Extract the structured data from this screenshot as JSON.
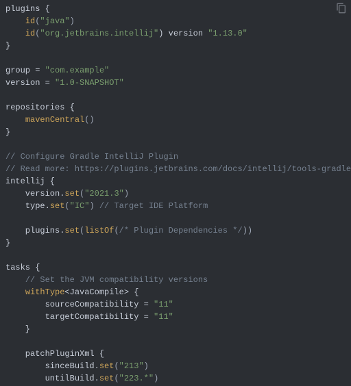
{
  "code": {
    "l1a": "plugins {",
    "l2a": "    ",
    "l2b": "id",
    "l2c": "(",
    "l2d": "\"java\"",
    "l2e": ")",
    "l3a": "    ",
    "l3b": "id",
    "l3c": "(",
    "l3d": "\"org.jetbrains.intellij\"",
    "l3e": ") version ",
    "l3f": "\"1.13.0\"",
    "l4a": "}",
    "l5a": "",
    "l6a": "group = ",
    "l6b": "\"com.example\"",
    "l7a": "version = ",
    "l7b": "\"1.0-SNAPSHOT\"",
    "l8a": "",
    "l9a": "repositories {",
    "l10a": "    ",
    "l10b": "mavenCentral",
    "l10c": "()",
    "l11a": "}",
    "l12a": "",
    "l13a": "// Configure Gradle IntelliJ Plugin",
    "l14a": "// Read more: https://plugins.jetbrains.com/docs/intellij/tools-gradle-intellij",
    "l15a": "intellij {",
    "l16a": "    version.",
    "l16b": "set",
    "l16c": "(",
    "l16d": "\"2021.3\"",
    "l16e": ")",
    "l17a": "    type.",
    "l17b": "set",
    "l17c": "(",
    "l17d": "\"IC\"",
    "l17e": ") ",
    "l17f": "// Target IDE Platform",
    "l18a": "",
    "l19a": "    plugins.",
    "l19b": "set",
    "l19c": "(",
    "l19d": "listOf",
    "l19e": "(",
    "l19f": "/* Plugin Dependencies */",
    "l19g": "))",
    "l20a": "}",
    "l21a": "",
    "l22a": "tasks {",
    "l23a": "    ",
    "l23b": "// Set the JVM compatibility versions",
    "l24a": "    ",
    "l24b": "withType",
    "l24c": "<JavaCompile> {",
    "l25a": "        sourceCompatibility = ",
    "l25b": "\"11\"",
    "l26a": "        targetCompatibility = ",
    "l26b": "\"11\"",
    "l27a": "    }",
    "l28a": "",
    "l29a": "    patchPluginXml {",
    "l30a": "        sinceBuild.",
    "l30b": "set",
    "l30c": "(",
    "l30d": "\"213\"",
    "l30e": ")",
    "l31a": "        untilBuild.",
    "l31b": "set",
    "l31c": "(",
    "l31d": "\"223.*\"",
    "l31e": ")"
  }
}
